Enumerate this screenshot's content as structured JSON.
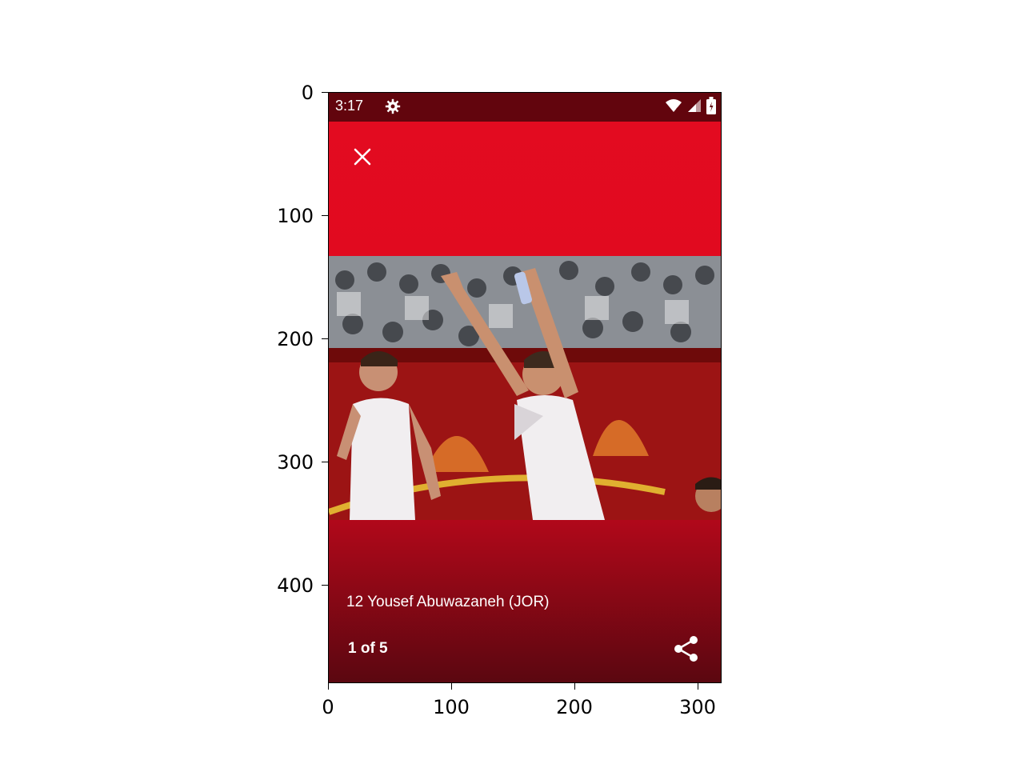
{
  "status_bar": {
    "time": "3:17",
    "icons": [
      "gear-icon",
      "wifi-icon",
      "signal-icon",
      "battery-icon"
    ]
  },
  "app_bar": {
    "close_icon": "close-icon"
  },
  "photo": {
    "description_icon": "photo"
  },
  "caption": {
    "text": "12 Yousef Abuwazaneh (JOR)",
    "counter": "1 of 5",
    "share_icon": "share-icon"
  },
  "axes": {
    "y_ticks": [
      "0",
      "100",
      "200",
      "300",
      "400"
    ],
    "x_ticks": [
      "0",
      "100",
      "200",
      "300"
    ]
  },
  "colors": {
    "accent": "#e30b20",
    "status": "#62050d"
  }
}
